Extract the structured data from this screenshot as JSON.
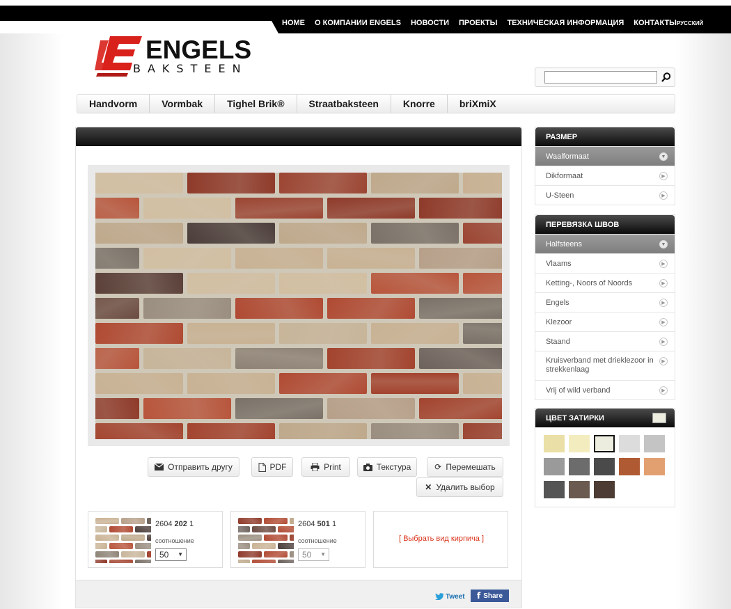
{
  "top_nav": {
    "items": [
      "HOME",
      "О КОМПАНИИ ENGELS",
      "НОВОСТИ",
      "ПРОЕКТЫ",
      "ТЕХНИЧЕСКАЯ ИНФОРМАЦИЯ",
      "КОНТАКТЫ"
    ],
    "language": "РУССКИЙ"
  },
  "logo": {
    "name": "ENGELS",
    "sub": "BAKSTEEN"
  },
  "search": {
    "value": "",
    "icon": "search-icon"
  },
  "product_tabs": [
    "Handvorm",
    "Vormbak",
    "Tighel Brik®",
    "Straatbaksteen",
    "Knorre",
    "briXmiX"
  ],
  "actions": {
    "send": "Отправить другу",
    "pdf": "PDF",
    "print": "Print",
    "texture": "Текстура",
    "shuffle": "Перемешать",
    "remove": "Удалить выбор"
  },
  "bricks": [
    {
      "code_prefix": "2604 ",
      "code_bold": "202",
      "code_suffix": " 1",
      "ratio_label": "соотношение",
      "ratio": "50"
    },
    {
      "code_prefix": "2604 ",
      "code_bold": "501",
      "code_suffix": " 1",
      "ratio_label": "соотношение",
      "ratio": "50"
    }
  ],
  "choose_brick": "[ Выбрать вид кирпича ]",
  "social": {
    "tweet": "Tweet",
    "share": "Share"
  },
  "size_box": {
    "title": "РАЗМЕР",
    "options": [
      "Waalformaat",
      "Dikformaat",
      "U-Steen"
    ],
    "active": "Waalformaat"
  },
  "bond_box": {
    "title": "ПЕРЕВЯЗКА ШВОВ",
    "options": [
      "Halfsteens",
      "Vlaams",
      "Ketting-, Noors of Noords",
      "Engels",
      "Klezoor",
      "Staand",
      "Kruisverband met drieklezoor in strekkenlaag",
      "Vrij of wild verband"
    ],
    "active": "Halfsteens"
  },
  "mortar_box": {
    "title": "ЦВЕТ ЗАТИРКИ",
    "current_color": "#ececdf",
    "swatches": [
      "#eadfa6",
      "#f3ecbe",
      "#ececdf",
      "#dcdcdc",
      "#c4c4c4",
      "#9a9a9a",
      "#6c6c6c",
      "#4a4a4a",
      "#b05a33",
      "#e2a071",
      "#555555",
      "#6b5a50",
      "#4d3c33"
    ],
    "selected_index": 2
  },
  "colors": {
    "brand_red": "#d9211c",
    "link_red": "#d9341c",
    "facebook": "#3b5998"
  }
}
